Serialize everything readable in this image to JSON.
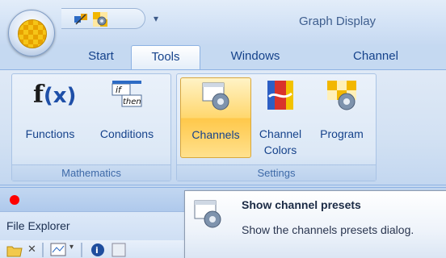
{
  "window": {
    "title": "Graph Display"
  },
  "tabs": [
    {
      "label": "Start"
    },
    {
      "label": "Tools",
      "selected": true
    },
    {
      "label": "Windows"
    },
    {
      "label": "Channel"
    }
  ],
  "ribbon": {
    "groups": [
      {
        "label": "Mathematics",
        "buttons": [
          {
            "label": "Functions",
            "icon": "function-fx-icon"
          },
          {
            "label": "Conditions",
            "icon": "if-then-icon"
          }
        ]
      },
      {
        "label": "Settings",
        "buttons": [
          {
            "label": "Channels",
            "icon": "channel-gear-icon",
            "highlighted": true
          },
          {
            "label": "Channel Colors",
            "line1": "Channel",
            "line2": "Colors",
            "icon": "channel-colors-icon"
          },
          {
            "label": "Program",
            "icon": "program-gear-icon"
          }
        ]
      }
    ]
  },
  "panel": {
    "title": "File Explorer"
  },
  "tooltip": {
    "title": "Show channel presets",
    "description": "Show the channels presets dialog."
  },
  "colors": {
    "accent": "#15428b",
    "highlight": "#ffd76e",
    "indicator": "#ff0000"
  }
}
